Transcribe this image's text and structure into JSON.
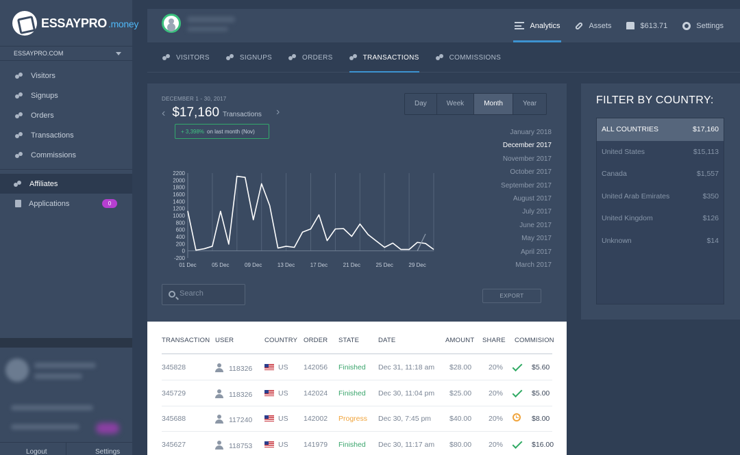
{
  "brand": {
    "name": "ESSAYPRO",
    "suffix": ".money"
  },
  "site_selector": {
    "value": "ESSAYPRO.COM"
  },
  "sidebar": {
    "items": [
      {
        "label": "Visitors",
        "icon": "users-icon"
      },
      {
        "label": "Signups",
        "icon": "user-add-icon"
      },
      {
        "label": "Orders",
        "icon": "bag-icon"
      },
      {
        "label": "Transactions",
        "icon": "transactions-icon"
      },
      {
        "label": "Commissions",
        "icon": "commissions-icon"
      }
    ],
    "affiliates": "Affiliates",
    "applications": {
      "label": "Applications",
      "badge": "0"
    },
    "logout": "Logout",
    "settings": "Settings"
  },
  "header": {
    "menu": [
      {
        "label": "Analytics",
        "icon": "list-icon",
        "active": true
      },
      {
        "label": "Assets",
        "icon": "link-icon"
      },
      {
        "label": "$613.71",
        "icon": "wallet-icon"
      },
      {
        "label": "Settings",
        "icon": "gear-icon"
      }
    ]
  },
  "tabs": [
    {
      "label": "VISITORS"
    },
    {
      "label": "SIGNUPS"
    },
    {
      "label": "ORDERS"
    },
    {
      "label": "TRANSACTIONS",
      "active": true
    },
    {
      "label": "COMMISSIONS"
    }
  ],
  "summary": {
    "date_range": "DECEMBER 1 - 30, 2017",
    "amount": "$17,160",
    "unit": "Transactions",
    "change_value": "+ 3,398%",
    "change_text": "on last month (Nov)"
  },
  "periods": [
    "Day",
    "Week",
    "Month",
    "Year"
  ],
  "active_period": "Month",
  "months": [
    "January 2018",
    "December 2017",
    "November 2017",
    "October 2017",
    "September 2017",
    "August 2017",
    "July 2017",
    "June 2017",
    "May 2017",
    "April 2017",
    "March 2017"
  ],
  "active_month": "December 2017",
  "chart_data": {
    "type": "line",
    "x": [
      "01 Dec",
      "02 Dec",
      "03 Dec",
      "04 Dec",
      "05 Dec",
      "06 Dec",
      "07 Dec",
      "08 Dec",
      "09 Dec",
      "10 Dec",
      "11 Dec",
      "12 Dec",
      "13 Dec",
      "14 Dec",
      "15 Dec",
      "16 Dec",
      "17 Dec",
      "18 Dec",
      "19 Dec",
      "20 Dec",
      "21 Dec",
      "22 Dec",
      "23 Dec",
      "24 Dec",
      "25 Dec",
      "26 Dec",
      "27 Dec",
      "28 Dec",
      "29 Dec",
      "30 Dec",
      "31 Dec"
    ],
    "x_ticks": [
      "01 Dec",
      "05 Dec",
      "09 Dec",
      "13 Dec",
      "17 Dec",
      "21 Dec",
      "25 Dec",
      "29 Dec"
    ],
    "y_ticks": [
      2200,
      2000,
      1800,
      1600,
      1400,
      1200,
      1000,
      800,
      600,
      400,
      200,
      0,
      -200
    ],
    "ylim": [
      -200,
      2200
    ],
    "series": [
      {
        "color": "#ffffff",
        "values": [
          1130,
          20,
          60,
          130,
          1120,
          190,
          2110,
          2080,
          880,
          1900,
          1280,
          80,
          130,
          100,
          530,
          620,
          1020,
          290,
          620,
          630,
          410,
          760,
          460,
          280,
          100,
          220,
          40,
          40,
          240,
          210,
          40
        ]
      },
      {
        "color": "#8a97a8",
        "values": [
          0,
          0,
          0,
          0,
          0,
          0,
          0,
          0,
          0,
          0,
          0,
          0,
          0,
          0,
          0,
          0,
          0,
          0,
          0,
          0,
          0,
          0,
          0,
          0,
          0,
          0,
          0,
          0,
          0,
          480,
          null
        ]
      }
    ],
    "grid": true
  },
  "search": {
    "placeholder": "Search"
  },
  "export_label": "EXPORT",
  "table": {
    "headers": [
      "TRANSACTION",
      "USER",
      "COUNTRY",
      "ORDER",
      "STATE",
      "DATE",
      "AMOUNT",
      "SHARE",
      "COMMISION"
    ],
    "rows": [
      {
        "transaction": "345828",
        "user": "118326",
        "country": "US",
        "order": "142056",
        "state": "Finished",
        "date": "Dec 31, 11:18 am",
        "amount": "$28.00",
        "share": "20%",
        "commission": "$5.60",
        "status_icon": "check-icon"
      },
      {
        "transaction": "345729",
        "user": "118326",
        "country": "US",
        "order": "142024",
        "state": "Finished",
        "date": "Dec 30, 11:04 pm",
        "amount": "$25.00",
        "share": "20%",
        "commission": "$5.00",
        "status_icon": "check-icon"
      },
      {
        "transaction": "345688",
        "user": "117240",
        "country": "US",
        "order": "142002",
        "state": "Progress",
        "date": "Dec 30, 7:45 pm",
        "amount": "$40.00",
        "share": "20%",
        "commission": "$8.00",
        "status_icon": "clock-icon"
      },
      {
        "transaction": "345627",
        "user": "118753",
        "country": "US",
        "order": "141979",
        "state": "Finished",
        "date": "Dec 30, 11:17 am",
        "amount": "$80.00",
        "share": "20%",
        "commission": "$16.00",
        "status_icon": "check-icon"
      }
    ]
  },
  "filter": {
    "title": "FILTER BY COUNTRY:",
    "items": [
      {
        "label": "ALL COUNTRIES",
        "value": "$17,160",
        "active": true
      },
      {
        "label": "United States",
        "value": "$15,113"
      },
      {
        "label": "Canada",
        "value": "$1,557"
      },
      {
        "label": "United Arab Emirates",
        "value": "$350"
      },
      {
        "label": "United Kingdom",
        "value": "$126"
      },
      {
        "label": "Unknown",
        "value": "$14"
      }
    ]
  },
  "colors": {
    "accent": "#3d93d1",
    "success": "#3aa56c",
    "warning": "#f0a33a",
    "badge": "#b63fd0"
  }
}
